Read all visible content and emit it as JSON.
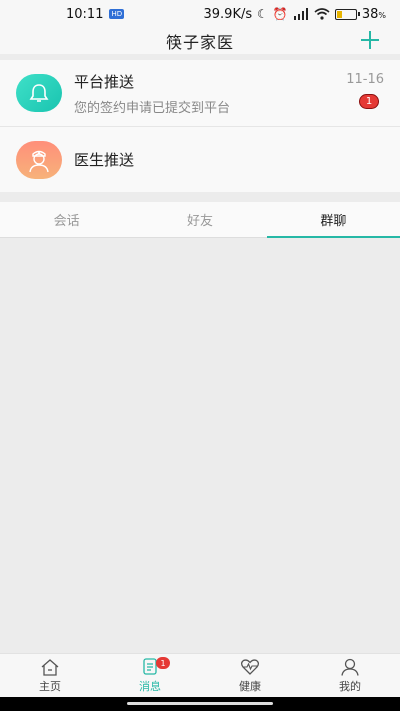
{
  "status_bar": {
    "time": "10:11",
    "badge": "HD",
    "network_speed": "39.9K/s",
    "signal_label": "HD",
    "battery_percent": "38",
    "battery_unit": "%",
    "battery_level": 0.38
  },
  "header": {
    "title": "筷子家医"
  },
  "push_list": [
    {
      "name": "平台推送",
      "subtitle": "您的签约申请已提交到平台",
      "date": "11-16",
      "unread": "1",
      "icon": "bell-icon"
    },
    {
      "name": "医生推送",
      "icon": "doctor-icon"
    }
  ],
  "tabs": [
    {
      "label": "会话",
      "active": false
    },
    {
      "label": "好友",
      "active": false
    },
    {
      "label": "群聊",
      "active": true
    }
  ],
  "bottom_nav": [
    {
      "label": "主页",
      "icon": "home-icon"
    },
    {
      "label": "消息",
      "icon": "message-icon",
      "badge": "1",
      "active": true
    },
    {
      "label": "健康",
      "icon": "health-heart-icon"
    },
    {
      "label": "我的",
      "icon": "profile-icon"
    }
  ],
  "colors": {
    "accent": "#26b8a6",
    "badge": "#e53935",
    "background": "#ececec"
  }
}
